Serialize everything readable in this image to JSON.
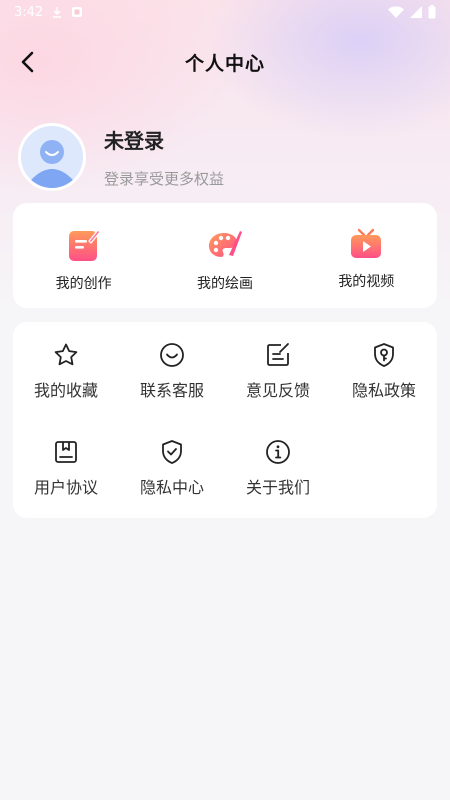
{
  "status_bar": {
    "time": "3:42"
  },
  "nav": {
    "title": "个人中心"
  },
  "profile": {
    "name": "未登录",
    "subtitle": "登录享受更多权益"
  },
  "top_items": [
    {
      "label": "我的创作",
      "icon": "creation-icon"
    },
    {
      "label": "我的绘画",
      "icon": "palette-icon"
    },
    {
      "label": "我的视频",
      "icon": "tv-play-icon"
    }
  ],
  "grid_items": [
    {
      "label": "我的收藏",
      "icon": "star-icon"
    },
    {
      "label": "联系客服",
      "icon": "smile-icon"
    },
    {
      "label": "意见反馈",
      "icon": "edit-note-icon"
    },
    {
      "label": "隐私政策",
      "icon": "shield-key-icon"
    },
    {
      "label": "用户协议",
      "icon": "bookmark-doc-icon"
    },
    {
      "label": "隐私中心",
      "icon": "shield-check-icon"
    },
    {
      "label": "关于我们",
      "icon": "info-icon"
    }
  ],
  "colors": {
    "accent_gradient_start": "#ff5f8f",
    "accent_gradient_end": "#ff9a5a",
    "background": "#f6f6f8"
  }
}
